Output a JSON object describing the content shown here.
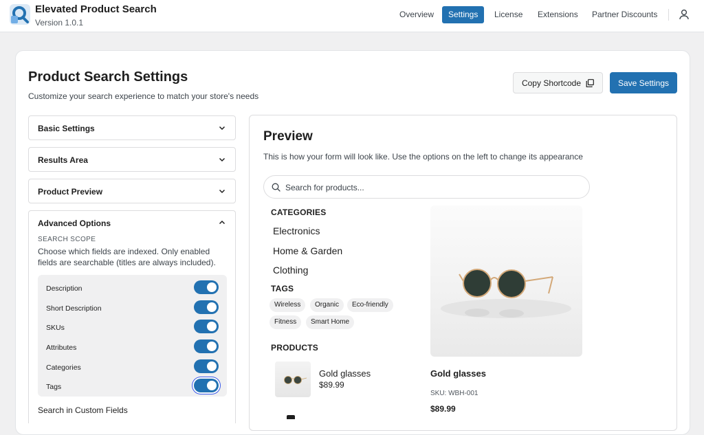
{
  "app": {
    "title": "Elevated Product Search",
    "version": "Version 1.0.1"
  },
  "nav": {
    "items": [
      "Overview",
      "Settings",
      "License",
      "Extensions",
      "Partner Discounts"
    ],
    "active": "Settings"
  },
  "header": {
    "title": "Product Search Settings",
    "subtitle": "Customize your search experience to match your store's needs",
    "copy_label": "Copy Shortcode",
    "save_label": "Save Settings"
  },
  "accordions": [
    {
      "label": "Basic Settings"
    },
    {
      "label": "Results Area"
    },
    {
      "label": "Product Preview"
    }
  ],
  "advanced": {
    "label": "Advanced Options",
    "scope_title": "SEARCH SCOPE",
    "scope_desc": "Choose which fields are indexed. Only enabled fields are searchable (titles are always included).",
    "toggles": [
      {
        "label": "Description",
        "on": true
      },
      {
        "label": "Short Description",
        "on": true
      },
      {
        "label": "SKUs",
        "on": true
      },
      {
        "label": "Attributes",
        "on": true
      },
      {
        "label": "Categories",
        "on": true
      },
      {
        "label": "Tags",
        "on": true
      }
    ],
    "custom_fields_label": "Search in Custom Fields"
  },
  "preview": {
    "title": "Preview",
    "subtitle": "This is how your form will look like. Use the options on the left to change its appearance",
    "search_placeholder": "Search for products...",
    "categories_head": "CATEGORIES",
    "categories": [
      "Electronics",
      "Home & Garden",
      "Clothing"
    ],
    "tags_head": "TAGS",
    "tags": [
      "Wireless",
      "Organic",
      "Eco-friendly",
      "Fitness",
      "Smart Home"
    ],
    "products_head": "PRODUCTS",
    "product": {
      "name": "Gold glasses",
      "price": "$89.99"
    },
    "featured": {
      "name": "Gold glasses",
      "sku": "SKU: WBH-001",
      "price": "$89.99"
    }
  },
  "colors": {
    "accent": "#2271b1",
    "focus": "#3858e9"
  },
  "icons": [
    "logo-icon",
    "user-icon",
    "copy-icon",
    "chevron-down-icon",
    "chevron-up-icon",
    "search-icon"
  ]
}
